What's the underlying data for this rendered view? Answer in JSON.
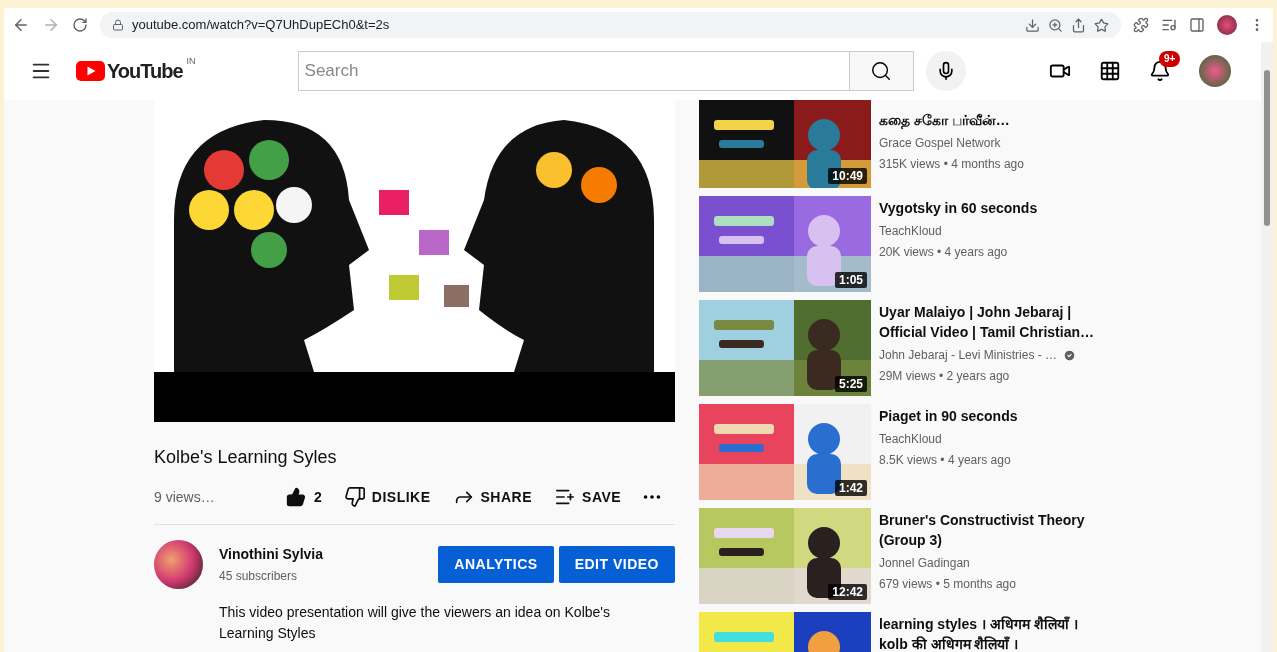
{
  "browser": {
    "url": "youtube.com/watch?v=Q7UhDupECh0&t=2s"
  },
  "header": {
    "logo_text": "YouTube",
    "region": "IN",
    "search_placeholder": "Search",
    "notification_count": "9+"
  },
  "video": {
    "title": "Kolbe's Learning Syles",
    "views": "9 views…",
    "likes": "2",
    "actions": [
      {
        "kind": "dislike",
        "label": "DISLIKE"
      },
      {
        "kind": "share",
        "label": "SHARE"
      },
      {
        "kind": "save",
        "label": "SAVE"
      }
    ]
  },
  "channel": {
    "name": "Vinothini Sylvia",
    "subscribers": "45 subscribers",
    "buttons": [
      "ANALYTICS",
      "EDIT VIDEO"
    ],
    "description": "This video presentation will give the viewers an idea on Kolbe's Learning Styles"
  },
  "related": [
    {
      "title_lines": [
        "கதை சகோ பர்வீன்…"
      ],
      "channel": "Grace Gospel Network",
      "verified": false,
      "meta": "315K views • 4 months ago",
      "duration": "10:49"
    },
    {
      "title_lines": [
        "Vygotsky in 60 seconds"
      ],
      "channel": "TeachKloud",
      "verified": false,
      "meta": "20K views • 4 years ago",
      "duration": "1:05"
    },
    {
      "title_lines": [
        "Uyar Malaiyo | John Jebaraj |",
        "Official Video | Tamil Christian…"
      ],
      "channel": "John Jebaraj - Levi Ministries - …",
      "verified": true,
      "meta": "29M views • 2 years ago",
      "duration": "5:25"
    },
    {
      "title_lines": [
        "Piaget in 90 seconds"
      ],
      "channel": "TeachKloud",
      "verified": false,
      "meta": "8.5K views • 4 years ago",
      "duration": "1:42"
    },
    {
      "title_lines": [
        "Bruner's Constructivist Theory",
        "(Group 3)"
      ],
      "channel": "Jonnel Gadingan",
      "verified": false,
      "meta": "679 views • 5 months ago",
      "duration": "12:42"
    },
    {
      "title_lines": [
        "learning styles । अधिगम शैलियाँ ।",
        "kolb की अधिगम शैलियाँ ।"
      ]
    }
  ]
}
